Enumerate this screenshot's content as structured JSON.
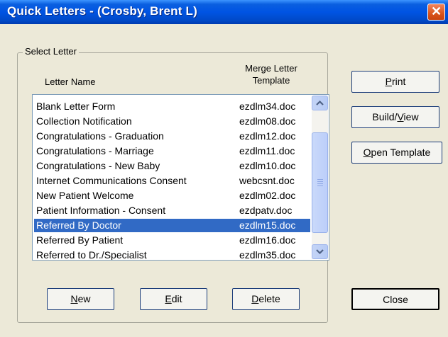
{
  "window": {
    "title": "Quick Letters - (Crosby, Brent L)",
    "close_glyph": "✕"
  },
  "group": {
    "label": "Select Letter",
    "col_letter_name": "Letter Name",
    "col_template_line1": "Merge Letter",
    "col_template_line2": "Template"
  },
  "letters": [
    {
      "name": "Blank Letter Form",
      "template": "ezdlm34.doc",
      "selected": false
    },
    {
      "name": "Collection Notification",
      "template": "ezdlm08.doc",
      "selected": false
    },
    {
      "name": "Congratulations - Graduation",
      "template": "ezdlm12.doc",
      "selected": false
    },
    {
      "name": "Congratulations - Marriage",
      "template": "ezdlm11.doc",
      "selected": false
    },
    {
      "name": "Congratulations - New Baby",
      "template": "ezdlm10.doc",
      "selected": false
    },
    {
      "name": "Internet Communications Consent",
      "template": "webcsnt.doc",
      "selected": false
    },
    {
      "name": "New Patient Welcome",
      "template": "ezdlm02.doc",
      "selected": false
    },
    {
      "name": "Patient Information - Consent",
      "template": "ezdpatv.doc",
      "selected": false
    },
    {
      "name": "Referred By Doctor",
      "template": "ezdlm15.doc",
      "selected": true
    },
    {
      "name": "Referred By Patient",
      "template": "ezdlm16.doc",
      "selected": false
    },
    {
      "name": "Referred to Dr./Specialist",
      "template": "ezdlm35.doc",
      "selected": false
    }
  ],
  "buttons": {
    "print": {
      "mnemonic": "P",
      "rest": "rint"
    },
    "build_view": {
      "pre": "Build/",
      "mnemonic": "V",
      "rest": "iew"
    },
    "open_template": {
      "mnemonic": "O",
      "rest": "pen Template"
    },
    "new": {
      "mnemonic": "N",
      "rest": "ew"
    },
    "edit": {
      "mnemonic": "E",
      "rest": "dit"
    },
    "delete": {
      "mnemonic": "D",
      "rest": "elete"
    },
    "close": {
      "label": "Close"
    }
  },
  "colors": {
    "selection": "#316ac5",
    "titlebar": "#0054e3",
    "dialog_bg": "#ece9d8"
  }
}
